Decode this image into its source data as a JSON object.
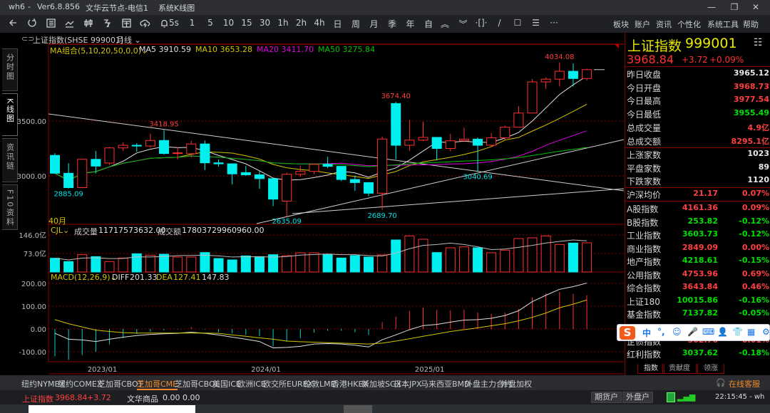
{
  "titlebar": {
    "app": "wh6",
    "sep": "-",
    "version": "Ver6.8.856",
    "server": "文华云节点-电信1",
    "view": "系统K线图",
    "min": "—",
    "max": "❐",
    "close": "✕"
  },
  "toolbar": {
    "icons": [
      "back-icon",
      "refresh-icon",
      "table-icon",
      "line-chart-icon",
      "candlestick-icon",
      "branch-icon",
      "window-icon",
      "cloud-icon",
      "bell-icon"
    ],
    "periods": [
      "5s",
      "1",
      "5",
      "10",
      "15",
      "30",
      "1h",
      "2h",
      "4h",
      "日",
      "周",
      "月",
      "季",
      "年",
      "自"
    ],
    "tools": [
      {
        "icon": "zoom-in-icon",
        "glyph": "︽"
      },
      {
        "icon": "zoom-out-icon",
        "glyph": "︾"
      },
      {
        "icon": "expand-icon",
        "glyph": "·[]·"
      },
      {
        "icon": "draw-line-icon",
        "glyph": "/"
      },
      {
        "icon": "rectangle-icon",
        "glyph": "☐"
      },
      {
        "icon": "text-lines-icon",
        "glyph": "☰"
      },
      {
        "icon": "more-icon",
        "glyph": "···"
      }
    ],
    "menu": [
      "板块",
      "账户",
      "资讯",
      "个性化",
      "系统工具",
      "帮助"
    ]
  },
  "sidetabs": [
    "分时图",
    "K线图",
    "资讯链",
    "F10资料"
  ],
  "chart_header": {
    "symbol": "上证指数(SHSE 999001)",
    "period": "月线 ⌄"
  },
  "ma_legend": {
    "label": "MA组合(5,10,20,50,0,0)⌄",
    "items": [
      {
        "name": "MA5",
        "value": "3910.59",
        "color": "#e0e0e0"
      },
      {
        "name": "MA10",
        "value": "3653.28",
        "color": "#d4c400"
      },
      {
        "name": "MA20",
        "value": "3411.70",
        "color": "#e000e0"
      },
      {
        "name": "MA50",
        "value": "3275.84",
        "color": "#00c000"
      }
    ]
  },
  "count_label": "40月",
  "vol_legend": {
    "label": "CJL⌄",
    "vol_name": "成交量",
    "vol": "11717573632.00",
    "amt_name": "成交额",
    "amt": "17803729960960.00"
  },
  "macd_legend": {
    "label": "MACD(12,26,9)⌄",
    "diff_name": "DIFF",
    "diff": "201.33",
    "dea_name": "DEA",
    "dea": "127.41",
    "macd": "147.83"
  },
  "annotations": [
    {
      "text": "4034.08",
      "color": "#ff4040",
      "price": 4034.08,
      "month": "2025/10",
      "pos": "above"
    },
    {
      "text": "3674.40",
      "color": "#ff4040",
      "price": 3674.4,
      "month": "2024/10",
      "pos": "above"
    },
    {
      "text": "3418.95",
      "color": "#ff4040",
      "price": 3418.95,
      "month": "2023/05",
      "pos": "above"
    },
    {
      "text": "2885.09",
      "color": "#00e5e5",
      "price": 2885.09,
      "month": "2022/10",
      "pos": "below"
    },
    {
      "text": "2635.09",
      "color": "#00e5e5",
      "price": 2635.09,
      "month": "2024/02",
      "pos": "below"
    },
    {
      "text": "2689.70",
      "color": "#00e5e5",
      "price": 2689.7,
      "month": "2024/09",
      "pos": "below"
    },
    {
      "text": "3040.69",
      "color": "#00e5e5",
      "price": 3040.69,
      "month": "2025/04",
      "pos": "below"
    }
  ],
  "chart_data": {
    "type": "candlestick",
    "price_axis": {
      "ticks": [
        "3500.00",
        "3000.00"
      ],
      "values": [
        3500,
        3000
      ]
    },
    "vol_axis": {
      "ticks": [
        "146.0亿",
        "73.0亿"
      ],
      "values": [
        146,
        73
      ],
      "unit": "亿"
    },
    "macd_axis": {
      "ticks": [
        "200.00",
        "100.00",
        "0.00",
        "-100.00"
      ],
      "values": [
        200,
        100,
        0,
        -100
      ]
    },
    "date_ticks": [
      "2023/01",
      "2024/01",
      "2025/01"
    ],
    "colors": {
      "up": "#ff3030",
      "down": "#00f0f0",
      "grid": "#8b0000"
    },
    "months": [
      "2022/09",
      "2022/10",
      "2022/11",
      "2022/12",
      "2023/01",
      "2023/02",
      "2023/03",
      "2023/04",
      "2023/05",
      "2023/06",
      "2023/07",
      "2023/08",
      "2023/09",
      "2023/10",
      "2023/11",
      "2023/12",
      "2024/01",
      "2024/02",
      "2024/03",
      "2024/04",
      "2024/05",
      "2024/06",
      "2024/07",
      "2024/08",
      "2024/09",
      "2024/10",
      "2024/11",
      "2024/12",
      "2025/01",
      "2025/02",
      "2025/03",
      "2025/04",
      "2025/05",
      "2025/06",
      "2025/07",
      "2025/08",
      "2025/09",
      "2025/10",
      "2025/11",
      "2025/12"
    ],
    "ohlc": [
      [
        3187,
        3207,
        3021,
        3024
      ],
      [
        3024,
        3115,
        2885.09,
        2893
      ],
      [
        2893,
        3154,
        2896,
        3151
      ],
      [
        3151,
        3226,
        3023,
        3089
      ],
      [
        3117,
        3265,
        3100,
        3255
      ],
      [
        3255,
        3305,
        3229,
        3279
      ],
      [
        3279,
        3298,
        3220,
        3272
      ],
      [
        3272,
        3386,
        3258,
        3323
      ],
      [
        3323,
        3418.95,
        3195,
        3204
      ],
      [
        3204,
        3263,
        3150,
        3210
      ],
      [
        3202,
        3322,
        3167,
        3291
      ],
      [
        3291,
        3322,
        3053,
        3119
      ],
      [
        3119,
        3150,
        3084,
        3110
      ],
      [
        3110,
        3110,
        2923,
        3018
      ],
      [
        3030,
        3090,
        3001,
        3010
      ],
      [
        3010,
        3044,
        2882,
        2975
      ],
      [
        2975,
        2976,
        2724,
        2788
      ],
      [
        2770,
        3030,
        2635.09,
        3015
      ],
      [
        3015,
        3092,
        2993,
        3041
      ],
      [
        3041,
        3113,
        3015,
        3105
      ],
      [
        3105,
        3174,
        3070,
        3087
      ],
      [
        3087,
        3090,
        2952,
        2967
      ],
      [
        2967,
        3004,
        2865,
        2939
      ],
      [
        2939,
        2939,
        2815,
        2842
      ],
      [
        2842,
        3358,
        2689.7,
        3336
      ],
      [
        3660,
        3674.4,
        3152,
        3279
      ],
      [
        3279,
        3509,
        3228,
        3326
      ],
      [
        3326,
        3494,
        3316,
        3351
      ],
      [
        3351,
        3351,
        3140,
        3250
      ],
      [
        3250,
        3383,
        3223,
        3320
      ],
      [
        3320,
        3439,
        3313,
        3335
      ],
      [
        3335,
        3350,
        3040.69,
        3279
      ],
      [
        3279,
        3391,
        3262,
        3347
      ],
      [
        3347,
        3459,
        3328,
        3444
      ],
      [
        3444,
        3636,
        3443,
        3573
      ],
      [
        3573,
        3883,
        3571,
        3857
      ],
      [
        3857,
        3899,
        3791,
        3882
      ],
      [
        3882,
        4034.08,
        3816,
        3954
      ],
      [
        3954,
        4025,
        3815,
        3888
      ],
      [
        3888,
        3977.54,
        3870,
        3968.84
      ]
    ],
    "volume": [
      54.3,
      41.2,
      68.3,
      60.8,
      41.2,
      55.2,
      72.1,
      66.4,
      70.2,
      59.0,
      59.0,
      76.7,
      53.3,
      47.7,
      63.6,
      60.8,
      68.3,
      64.6,
      75.8,
      75.8,
      70.2,
      55.2,
      64.6,
      59.0,
      67.4,
      126.3,
      142.3,
      129.2,
      76.7,
      95.5,
      99.2,
      95.5,
      75.8,
      86.1,
      132.0,
      134.8,
      142.3,
      108.6,
      114.2,
      115.1
    ],
    "diff": [
      -19,
      -45,
      -48,
      -55,
      -45,
      -36,
      -29,
      -24,
      -21,
      -19,
      -14,
      -19,
      -26,
      -36,
      -45,
      -55,
      -83,
      -81,
      -76,
      -66,
      -64,
      -66,
      -71,
      -79,
      -47,
      -26,
      -3,
      15,
      20,
      30,
      39,
      41,
      47,
      59,
      80,
      120,
      148,
      174,
      186,
      201.33
    ],
    "dea": [
      41,
      23,
      9,
      -5,
      -11,
      -16,
      -18,
      -18,
      -18,
      -18,
      -18,
      -18,
      -19,
      -26,
      -32,
      -39,
      -45,
      -53,
      -56,
      -58,
      -60,
      -62,
      -64,
      -66,
      -62,
      -53,
      -43,
      -32,
      -22,
      -11,
      -3,
      5,
      14,
      23,
      36,
      51,
      70,
      93,
      109,
      127.41
    ],
    "macd": [
      -120,
      -136,
      -114,
      -100,
      -68,
      -40,
      -22,
      -12,
      -6,
      -2,
      8,
      -2,
      -14,
      -20,
      -26,
      -32,
      -76,
      -56,
      -40,
      -16,
      -8,
      -8,
      -14,
      -26,
      30,
      54,
      80,
      94,
      84,
      82,
      84,
      72,
      66,
      72,
      88,
      138,
      156,
      162,
      154,
      147.83
    ]
  },
  "quote": {
    "name": "上证指数",
    "code": "999001",
    "price": "3968.84",
    "change": "+3.72",
    "pct": "+0.09%",
    "list_icon": "list-icon",
    "stats": [
      {
        "k": "昨日收盘",
        "v": "3965.12",
        "c": "#e8e8e8"
      },
      {
        "k": "今日开盘",
        "v": "3968.73",
        "c": "#ff4040"
      },
      {
        "k": "今日最高",
        "v": "3977.54",
        "c": "#ff4040"
      },
      {
        "k": "今日最低",
        "v": "3955.49",
        "c": "#00e000"
      },
      {
        "k": "总成交量",
        "v": "4.9亿",
        "c": "#ff4040"
      },
      {
        "k": "总成交额",
        "v": "8295.1亿",
        "c": "#ff4040"
      }
    ],
    "breadth": [
      {
        "k": "上涨家数",
        "v": "1023",
        "c": "#e8e8e8"
      },
      {
        "k": "平盘家数",
        "v": "89",
        "c": "#e8e8e8"
      },
      {
        "k": "下跌家数",
        "v": "1120",
        "c": "#e8e8e8"
      }
    ],
    "avg": {
      "k": "沪深均价",
      "m": "21.17",
      "v": "0.07%",
      "c": "#ff4040"
    },
    "indices": [
      {
        "k": "A股指数",
        "m": "4161.36",
        "v": "0.09%",
        "c": "#ff4040"
      },
      {
        "k": "B股指数",
        "m": "253.82",
        "v": "-0.12%",
        "c": "#00e000"
      },
      {
        "k": "工业指数",
        "m": "3603.73",
        "v": "-0.12%",
        "c": "#00e000"
      },
      {
        "k": "商业指数",
        "m": "2849.09",
        "v": "0.00%",
        "c": "#ff4040"
      },
      {
        "k": "地产指数",
        "m": "4218.61",
        "v": "-0.15%",
        "c": "#00e000"
      },
      {
        "k": "公用指数",
        "m": "4753.96",
        "v": "0.69%",
        "c": "#ff4040"
      },
      {
        "k": "综合指数",
        "m": "3643.84",
        "v": "0.46%",
        "c": "#ff4040"
      },
      {
        "k": "上证180",
        "m": "10015.86",
        "v": "-0.16%",
        "c": "#00e000"
      },
      {
        "k": "基金指数",
        "m": "7137.82",
        "v": "-0.05%",
        "c": "#00e000"
      },
      {
        "k": "",
        "m": "",
        "v": "",
        "c": "#ff4040"
      },
      {
        "k": "企债指数",
        "m": "302.76",
        "v": "0.01%",
        "c": "#ff4040"
      },
      {
        "k": "红利指数",
        "m": "3037.62",
        "v": "-0.18%",
        "c": "#00e000"
      }
    ],
    "tabs": [
      "指数",
      "贡献度",
      "领涨"
    ]
  },
  "ime": {
    "logo": "S",
    "items": [
      "中",
      "°,",
      "☺",
      "🎤",
      "⌨",
      "👤",
      "👕",
      "▦",
      "⚙"
    ]
  },
  "exchanges": {
    "items": [
      "纽约NYMEX",
      "纽约COMEX",
      "芝加哥CBOT",
      "芝加哥CME",
      "芝加哥CBOE",
      "美国ICE",
      "欧洲ICE",
      "欧交所EUREX",
      "伦敦LME",
      "香港HKEX",
      "新加坡SGX",
      "日本JPX",
      "马来西亚BMD",
      "外盘主力合约",
      "外盘加权"
    ],
    "active": 3,
    "service": "在线客服"
  },
  "status": {
    "index_name": "上证指数",
    "index_price": "3968.84",
    "index_change": "+3.72",
    "wh_name": "文华商品",
    "wh_price": "0.00",
    "wh_change": "0.00",
    "btn_futures": "期货户",
    "btn_foreign": "外盘户",
    "time": "22:15:45 - wh"
  }
}
